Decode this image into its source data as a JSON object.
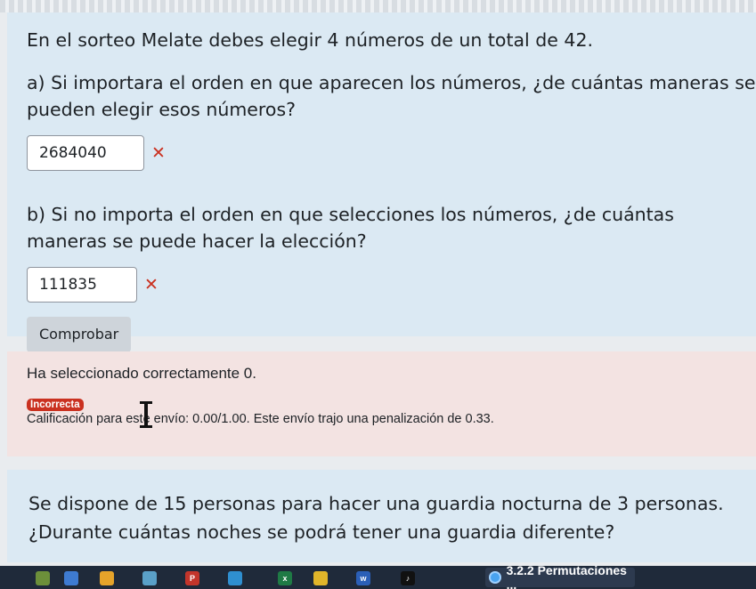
{
  "question1": {
    "intro": "En el sorteo Melate debes elegir 4 números de un total de 42.",
    "part_a": {
      "text": "a) Si importara el orden en que aparecen los números, ¿de cuántas maneras se pueden elegir esos números?",
      "answer": "2684040",
      "mark": "✕"
    },
    "part_b": {
      "text": "b) Si no importa el orden en que selecciones los números, ¿de cuántas maneras se puede hacer la elección?",
      "answer": "111835",
      "mark": "✕"
    },
    "check_button": "Comprobar"
  },
  "feedback": {
    "selected_text": "Ha seleccionado correctamente 0.",
    "badge": "Incorrecta",
    "grade_text": "Calificación para este envío: 0.00/1.00. Este envío trajo una penalización de 0.33."
  },
  "question2": {
    "line1": "Se dispone de 15 personas para hacer una guardia nocturna de 3 personas.",
    "line2": "¿Durante cuántas noches se podrá tener una guardia diferente?"
  },
  "taskbar": {
    "icons": [
      {
        "name": "app-icon-1",
        "glyph": "",
        "color": "#6c8f3a"
      },
      {
        "name": "app-icon-2",
        "glyph": "",
        "color": "#3e7bd1"
      },
      {
        "name": "app-icon-3",
        "glyph": "",
        "color": "#e5a32a"
      },
      {
        "name": "app-icon-4",
        "glyph": "",
        "color": "#5aa0c8"
      },
      {
        "name": "app-icon-5",
        "glyph": "P",
        "color": "#c2352b"
      },
      {
        "name": "app-icon-6",
        "glyph": "",
        "color": "#2f8fd0"
      },
      {
        "name": "excel-icon",
        "glyph": "x",
        "color": "#1f7a45"
      },
      {
        "name": "chrome-icon",
        "glyph": "",
        "color": "#e0b52a"
      },
      {
        "name": "word-icon",
        "glyph": "w",
        "color": "#2b5fb7"
      },
      {
        "name": "tiktok-icon",
        "glyph": "♪",
        "color": "#111111"
      }
    ],
    "active_window": "3.2.2 Permutaciones ..."
  }
}
